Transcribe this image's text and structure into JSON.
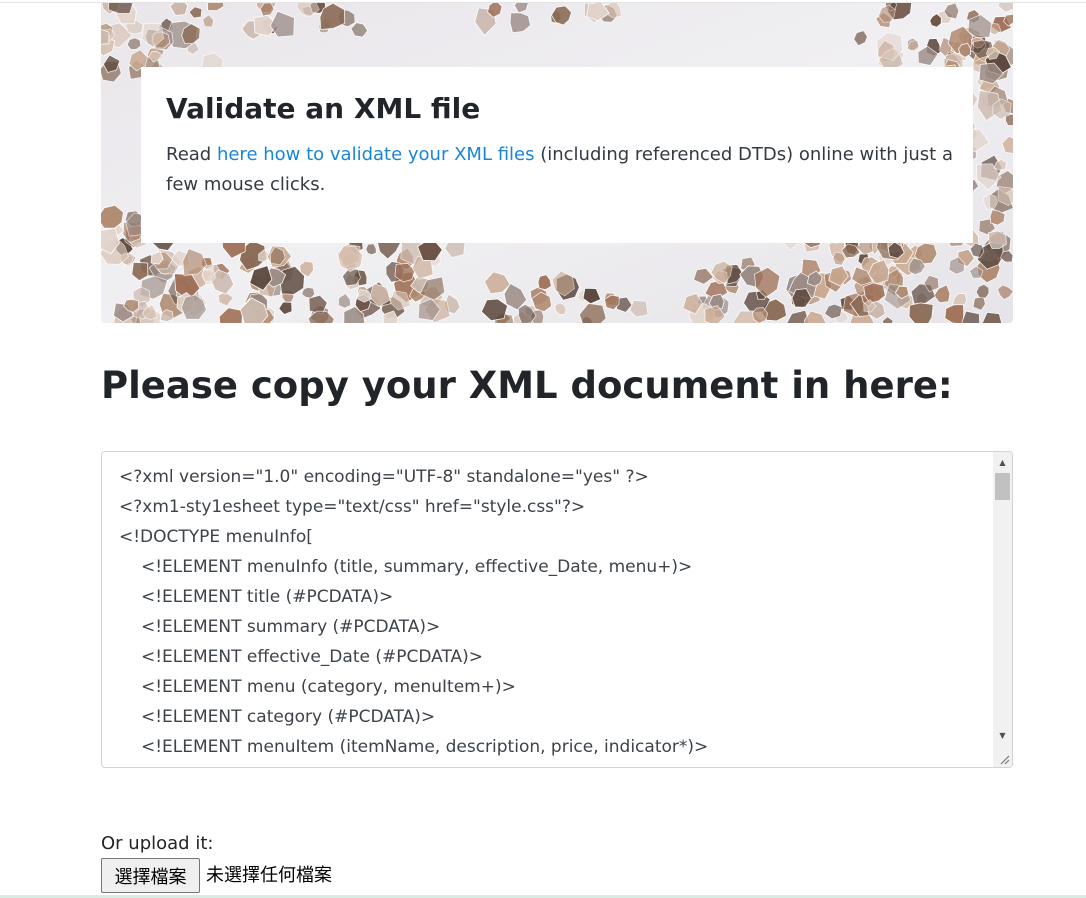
{
  "hero": {
    "title": "Validate an XML file",
    "text_before": "Read ",
    "link_text": "here how to validate your XML files",
    "text_after": " (including referenced DTDs) online with just a few mouse clicks.",
    "link_color": "#1a86d8"
  },
  "main": {
    "heading": "Please copy your XML document in here:"
  },
  "editor": {
    "lines": [
      "<?xml version=\"1.0\" encoding=\"UTF-8\" standalone=\"yes\" ?>",
      "<?xm1-sty1esheet type=\"text/css\" href=\"style.css\"?>",
      "<!DOCTYPE menuInfo[",
      "<!ELEMENT menuInfo (title, summary, effective_Date, menu+)>",
      "<!ELEMENT title (#PCDATA)>",
      "<!ELEMENT summary (#PCDATA)>",
      "<!ELEMENT effective_Date (#PCDATA)>",
      "<!ELEMENT menu (category, menuItem+)>",
      "<!ELEMENT category (#PCDATA)>",
      "<!ELEMENT menuItem (itemName, description, price, indicator*)>"
    ]
  },
  "upload": {
    "label": "Or upload it:",
    "button_label": "選擇檔案",
    "status": "未選擇任何檔案"
  }
}
